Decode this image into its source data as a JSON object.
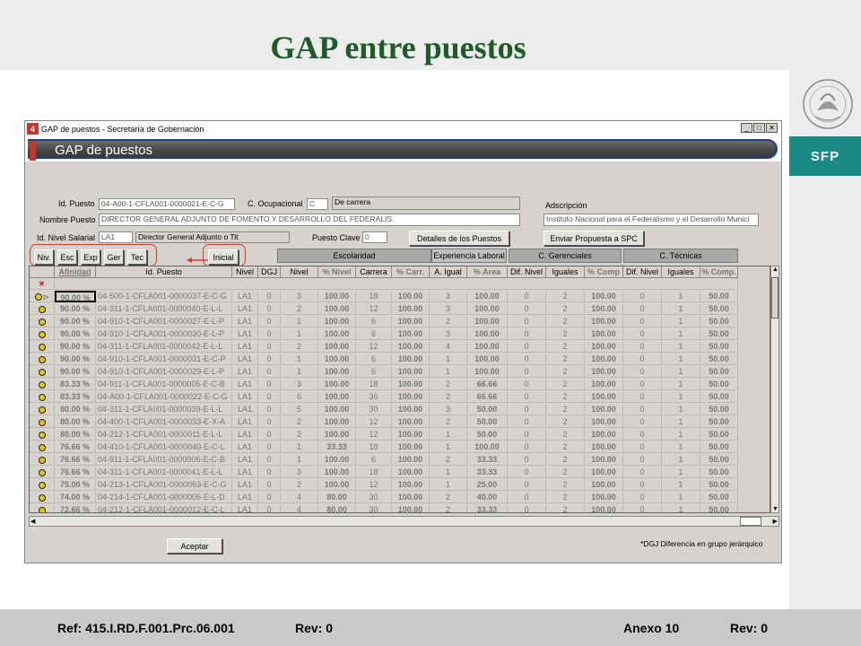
{
  "slide": {
    "title": "GAP entre puestos",
    "footer": {
      "ref": "Ref: 415.I.RD.F.001.Prc.06.001",
      "rev_left": "Rev: 0",
      "anexo": "Anexo 10",
      "rev_right": "Rev: 0"
    },
    "brand": "SFP"
  },
  "window": {
    "app_icon": "4",
    "title": "GAP de puestos - Secretaría de Gobernación",
    "controls": [
      "_",
      "□",
      "✕"
    ],
    "header": "GAP de puestos"
  },
  "form": {
    "id_puesto_label": "Id. Puesto",
    "id_puesto_value": "04-A00-1-CFLA001-0000021-E-C-G",
    "c_ocupacional_label": "C. Ocupacional",
    "c_ocupacional_value": "C",
    "c_ocupacional_desc": "De carrera",
    "adscripcion_label": "Adscripción",
    "adscripcion_value": "Instituto Nacional para el Federalismo y el Desarrollo Munici",
    "nombre_puesto_label": "Nombre Puesto",
    "nombre_puesto_value": "DIRECTOR GENERAL ADJUNTO DE FOMENTO Y DESARROLLO DEL FEDERALIS",
    "id_nivel_label": "Id. Nivel Salarial",
    "id_nivel_value": "LA1",
    "id_nivel_desc": "Director General Adjunto o Tit",
    "puesto_clave_label": "Puesto Clave",
    "puesto_clave_value": "0",
    "detalles_button": "Detalles de los Puestos",
    "enviar_button": "Enviar Propuesta a SPC",
    "filter_buttons": [
      "Niv.",
      "Esc",
      "Exp",
      "Ger",
      "Tec"
    ],
    "inicial_button": "Inicial",
    "aceptar_button": "Aceptar",
    "footnote": "*DGJ  Diferencia en grupo jerárquico"
  },
  "group_headers": [
    "Escolaridad",
    "Experiencia Laboral",
    "C. Gerenciales",
    "C. Técnicas"
  ],
  "columns": [
    "Afinidad",
    "Id. Puesto",
    "Nivel",
    "DGJ",
    "Nivel",
    "% Nivel",
    "Carrera",
    "% Carr.",
    "A. Igual",
    "% Area",
    "Dif. Nivel",
    "Iguales",
    "% Comp",
    "Dif. Nivel",
    "Iguales",
    "% Comp."
  ],
  "new_row_marker": "✖",
  "rows": [
    [
      "90.00 %",
      "04-500-1-CFLA001-0000037-E-C-G",
      "LA1",
      "0",
      "3",
      "100.00",
      "18",
      "100.00",
      "3",
      "100.00",
      "0",
      "2",
      "100.00",
      "0",
      "1",
      "50.00"
    ],
    [
      "90.00 %",
      "04-311-1-CFLA001-0000040-E-L-L",
      "LA1",
      "0",
      "2",
      "100.00",
      "12",
      "100.00",
      "3",
      "100.00",
      "0",
      "2",
      "100.00",
      "0",
      "1",
      "50.00"
    ],
    [
      "90.00 %",
      "04-910-1-CFLA001-0000027-E-L-P",
      "LA1",
      "0",
      "1",
      "100.00",
      "6",
      "100.00",
      "2",
      "100.00",
      "0",
      "2",
      "100.00",
      "0",
      "1",
      "50.00"
    ],
    [
      "90.00 %",
      "04-910-1-CFLA001-0000030-E-L-P",
      "LA1",
      "0",
      "1",
      "100.00",
      "6",
      "100.00",
      "3",
      "100.00",
      "0",
      "2",
      "100.00",
      "0",
      "1",
      "50.00"
    ],
    [
      "90.00 %",
      "04-311-1-CFLA001-0000042-E-L-L",
      "LA1",
      "0",
      "2",
      "100.00",
      "12",
      "100.00",
      "4",
      "100.00",
      "0",
      "2",
      "100.00",
      "0",
      "1",
      "50.00"
    ],
    [
      "90.00 %",
      "04-910-1-CFLA001-0000031-E-C-P",
      "LA1",
      "0",
      "1",
      "100.00",
      "6",
      "100.00",
      "1",
      "100.00",
      "0",
      "2",
      "100.00",
      "0",
      "1",
      "50.00"
    ],
    [
      "90.00 %",
      "04-910-1-CFLA001-0000029-E-L-P",
      "LA1",
      "0",
      "1",
      "100.00",
      "6",
      "100.00",
      "1",
      "100.00",
      "0",
      "2",
      "100.00",
      "0",
      "1",
      "50.00"
    ],
    [
      "83.33 %",
      "04-911-1-CFLA001-0000005-E-C-B",
      "LA1",
      "0",
      "3",
      "100.00",
      "18",
      "100.00",
      "2",
      "66.66",
      "0",
      "2",
      "100.00",
      "0",
      "1",
      "50.00"
    ],
    [
      "83.33 %",
      "04-A00-1-CFLA001-0000022-E-C-G",
      "LA1",
      "0",
      "6",
      "100.00",
      "36",
      "100.00",
      "2",
      "66.66",
      "0",
      "2",
      "100.00",
      "0",
      "1",
      "50.00"
    ],
    [
      "80.00 %",
      "04-311-1-CFLA001-0000039-E-L-L",
      "LA1",
      "0",
      "5",
      "100.00",
      "30",
      "100.00",
      "3",
      "50.00",
      "0",
      "2",
      "100.00",
      "0",
      "1",
      "50.00"
    ],
    [
      "80.00 %",
      "04-400-1-CFLA001-0000033-E-X-A",
      "LA1",
      "0",
      "2",
      "100.00",
      "12",
      "100.00",
      "2",
      "50.00",
      "0",
      "2",
      "100.00",
      "0",
      "1",
      "50.00"
    ],
    [
      "80.00 %",
      "04-212-1-CFLA001-0000011-E-L-L",
      "LA1",
      "0",
      "2",
      "100.00",
      "12",
      "100.00",
      "1",
      "50.00",
      "0",
      "2",
      "100.00",
      "0",
      "1",
      "50.00"
    ],
    [
      "76.66 %",
      "04-410-1-CFLA001-0000040-E-C-L",
      "LA1",
      "0",
      "1",
      "33.33",
      "18",
      "100.00",
      "1",
      "100.00",
      "0",
      "2",
      "100.00",
      "0",
      "1",
      "50.00"
    ],
    [
      "76.66 %",
      "04-911-1-CFLA001-0000006-E-C-B",
      "LA1",
      "0",
      "1",
      "100.00",
      "6",
      "100.00",
      "2",
      "33.33",
      "0",
      "2",
      "100.00",
      "0",
      "1",
      "50.00"
    ],
    [
      "76.66 %",
      "04-311-1-CFLA001-0000041-E-L-L",
      "LA1",
      "0",
      "3",
      "100.00",
      "18",
      "100.00",
      "1",
      "33.33",
      "0",
      "2",
      "100.00",
      "0",
      "1",
      "50.00"
    ],
    [
      "75.00 %",
      "04-213-1-CFLA001-0000063-E-C-G",
      "LA1",
      "0",
      "2",
      "100.00",
      "12",
      "100.00",
      "1",
      "25.00",
      "0",
      "2",
      "100.00",
      "0",
      "1",
      "50.00"
    ],
    [
      "74.00 %",
      "04-214-1-CFLA001-0000006-E-L-D",
      "LA1",
      "0",
      "4",
      "80.00",
      "30",
      "100.00",
      "2",
      "40.00",
      "0",
      "2",
      "100.00",
      "0",
      "1",
      "50.00"
    ],
    [
      "72.66 %",
      "04-212-1-CFLA001-0000012-E-C-L",
      "LA1",
      "0",
      "4",
      "80.00",
      "30",
      "100.00",
      "2",
      "33.33",
      "0",
      "2",
      "100.00",
      "0",
      "1",
      "50.00"
    ]
  ],
  "icons": {
    "row_indicator": "yellow-dot-icon",
    "current_row": "triangle-right-icon"
  },
  "colors": {
    "title_green": "#1f5a2a",
    "brand_teal": "#1a8a86",
    "highlight_red": "#d23c2e"
  }
}
